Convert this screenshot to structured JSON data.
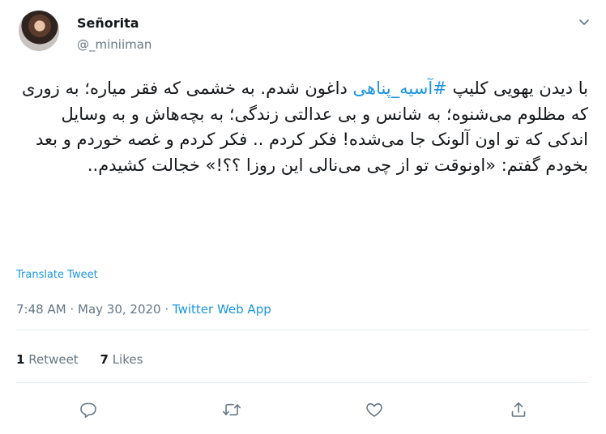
{
  "user": {
    "display_name": "Señorita",
    "handle": "@_miniiman"
  },
  "tweet": {
    "text_before_hashtag": "با دیدن یهویی کلیپ ",
    "hashtag": "#آسیه_پناهی",
    "text_after_hashtag": " داغون شدم. به خشمی که فقر میاره؛ به زوری که مظلوم می‌شنوه؛ به شانس و بی عدالتی زندگی؛ به بچه‌هاش و به وسایل اندکی که تو اون آلونک جا می‌شده! فکر کردم .. فکر کردم و غصه خوردم و بعد بخودم گفتم: «اونوقت تو از چی می‌نالی این روزا ؟؟!» خجالت کشیدم..",
    "translate_label": "Translate Tweet",
    "time": "7:48 AM",
    "separator": "·",
    "date": "May 30, 2020",
    "source": "Twitter Web App"
  },
  "stats": {
    "retweets_count": "1",
    "retweets_label": "Retweet",
    "likes_count": "7",
    "likes_label": "Likes"
  },
  "colors": {
    "link": "#1b95e0",
    "secondary_text": "#657786",
    "divider": "#e6ecf0",
    "text": "#14171a"
  },
  "icons": {
    "reply": "reply-icon",
    "retweet": "retweet-icon",
    "like": "like-icon",
    "share": "share-icon",
    "more": "chevron-down-icon"
  }
}
